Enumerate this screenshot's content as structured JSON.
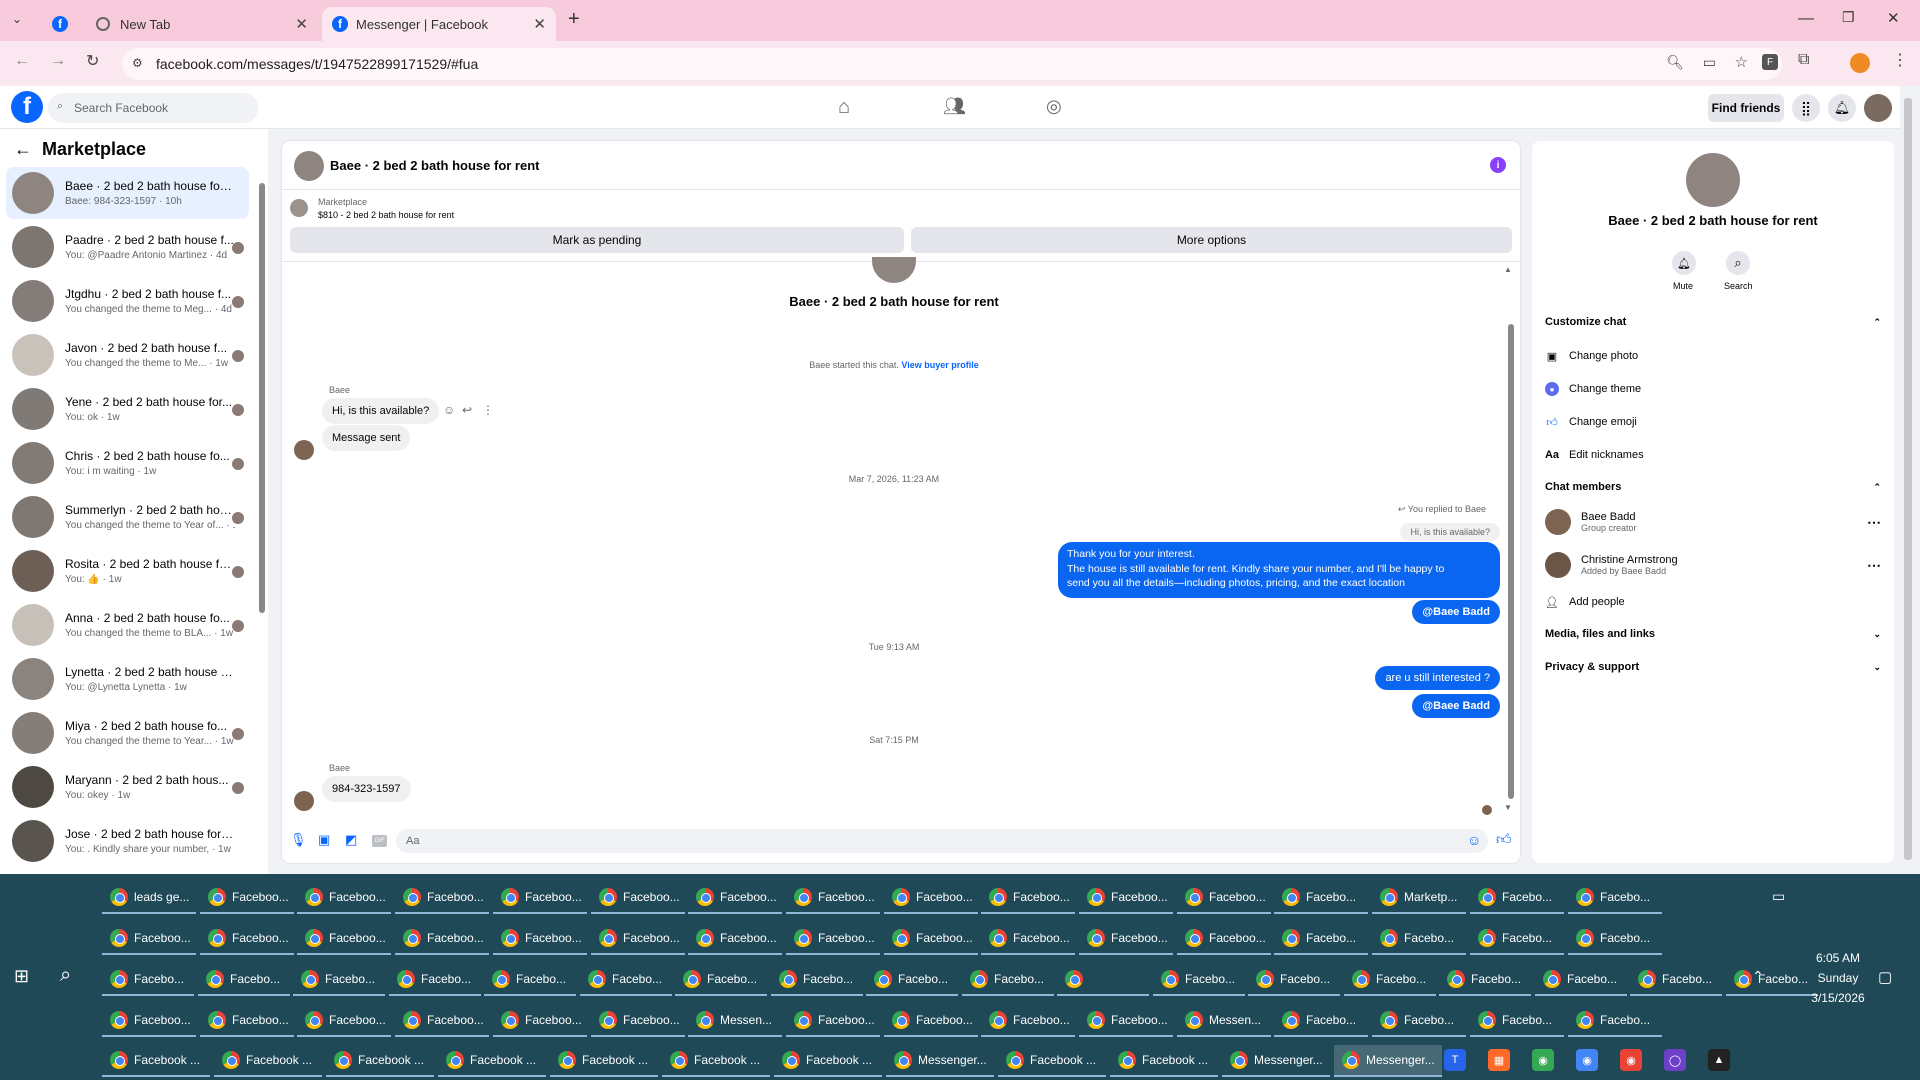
{
  "browser": {
    "tabs": [
      {
        "title": ""
      },
      {
        "title": "New Tab"
      },
      {
        "title": "Messenger | Facebook"
      }
    ],
    "new_tab": "+",
    "url": "facebook.com/messages/t/1947522899171529/#fua"
  },
  "fb": {
    "search_placeholder": "Search Facebook",
    "find_friends": "Find friends"
  },
  "sidebar": {
    "title": "Marketplace",
    "items": [
      {
        "name": "Baee · 2 bed 2 bath house for r...",
        "preview": "Baee: 984-323-1597 · 10h",
        "selected": true,
        "color": "#8f8580"
      },
      {
        "name": "Paadre · 2 bed 2 bath house f...",
        "preview": "You: @Paadre Antonio Martinez · 4d",
        "color": "#7d7570"
      },
      {
        "name": "Jtgdhu · 2 bed 2 bath house f...",
        "preview": "You changed the theme to Meg... · 4d",
        "color": "#847c78"
      },
      {
        "name": "Javon · 2 bed 2 bath house f...",
        "preview": "You changed the theme to Me... · 1w",
        "color": "#c8c2bb"
      },
      {
        "name": "Yene · 2 bed 2 bath house for...",
        "preview": "You: ok · 1w",
        "color": "#7f7a76"
      },
      {
        "name": "Chris · 2 bed 2 bath house fo...",
        "preview": "You: i m waiting · 1w",
        "color": "#827a74"
      },
      {
        "name": "Summerlyn · 2 bed 2 bath hous...",
        "preview": "You changed the theme to Year of... · 1w",
        "color": "#7e7772"
      },
      {
        "name": "Rosita · 2 bed 2 bath house for ...",
        "preview": "You: 👍 · 1w",
        "color": "#6d5f55"
      },
      {
        "name": "Anna · 2 bed 2 bath house fo...",
        "preview": "You changed the theme to BLA... · 1w",
        "color": "#c6c0b9"
      },
      {
        "name": "Lynetta · 2 bed 2 bath house fo...",
        "preview": "You: @Lynetta Lynetta · 1w",
        "color": "#8a837e"
      },
      {
        "name": "Miya · 2 bed 2 bath house fo...",
        "preview": "You changed the theme to Year... · 1w",
        "color": "#847d78"
      },
      {
        "name": "Maryann · 2 bed 2 bath hous...",
        "preview": "You: okey · 1w",
        "color": "#4e4842"
      },
      {
        "name": "Jose · 2 bed 2 bath house for rent",
        "preview": "You: . Kindly share your number, · 1w",
        "color": "#5a544f"
      }
    ]
  },
  "chat": {
    "title": "Baee · 2 bed 2 bath house for rent",
    "listing_label": "Marketplace",
    "listing_price": "$810 - 2 bed 2 bath house for rent",
    "mark_pending": "Mark as pending",
    "more_options": "More options",
    "profile_name": "Baee · 2 bed 2 bath house for rent",
    "started": "Baee started this chat.",
    "view_buyer": "View buyer profile",
    "sender1": "Baee",
    "msg1": "Hi, is this available?",
    "msg2": "Message sent",
    "date1": "Mar 7, 2026, 11:23 AM",
    "replied": "You replied to Baee",
    "quoted": "Hi, is this available?",
    "reply_lines": [
      "Thank you for your interest.",
      "The house is still available for rent. Kindly share your number, and I'll be happy to",
      "send you all the details—including photos, pricing, and the exact location"
    ],
    "mention": "@Baee Badd",
    "date2": "Tue 9:13 AM",
    "msg3": "are u still interested ?",
    "date3": "Sat 7:15 PM",
    "sender2": "Baee",
    "msg4": "984-323-1597",
    "composer_placeholder": "Aa"
  },
  "panel": {
    "name": "Baee · 2 bed 2 bath house for rent",
    "mute": "Mute",
    "search": "Search",
    "customize": "Customize chat",
    "change_photo": "Change photo",
    "change_theme": "Change theme",
    "change_emoji": "Change emoji",
    "edit_nicknames": "Edit nicknames",
    "members_title": "Chat members",
    "members": [
      {
        "name": "Baee Badd",
        "role": "Group creator"
      },
      {
        "name": "Christine Armstrong",
        "role": "Added by Baee Badd"
      }
    ],
    "add_people": "Add people",
    "media": "Media, files and links",
    "privacy": "Privacy & support"
  },
  "taskbar": {
    "rows": [
      [
        "leads ge...",
        "Faceboo...",
        "Faceboo...",
        "Faceboo...",
        "Faceboo...",
        "Faceboo...",
        "Faceboo...",
        "Faceboo...",
        "Faceboo...",
        "Faceboo...",
        "Faceboo...",
        "Faceboo...",
        "Facebo...",
        "Marketp...",
        "Facebo...",
        "Facebo..."
      ],
      [
        "Faceboo...",
        "Faceboo...",
        "Faceboo...",
        "Faceboo...",
        "Faceboo...",
        "Faceboo...",
        "Faceboo...",
        "Faceboo...",
        "Faceboo...",
        "Faceboo...",
        "Faceboo...",
        "Faceboo...",
        "Facebo...",
        "Facebo...",
        "Facebo...",
        "Facebo..."
      ],
      [
        "Facebo...",
        "Facebo...",
        "Facebo...",
        "Facebo...",
        "Facebo...",
        "Facebo...",
        "Facebo...",
        "Facebo...",
        "Facebo...",
        "Facebo...",
        "",
        "Facebo...",
        "Facebo...",
        "Facebo...",
        "Facebo...",
        "Facebo...",
        "Facebo...",
        "Facebo..."
      ],
      [
        "Faceboo...",
        "Faceboo...",
        "Faceboo...",
        "Faceboo...",
        "Faceboo...",
        "Faceboo...",
        "Messen...",
        "Faceboo...",
        "Faceboo...",
        "Faceboo...",
        "Faceboo...",
        "Messen...",
        "Facebo...",
        "Facebo...",
        "Facebo...",
        "Facebo..."
      ],
      [
        "Facebook ...",
        "Facebook ...",
        "Facebook ...",
        "Facebook ...",
        "Facebook ...",
        "Facebook ...",
        "Facebook ...",
        "Messenger...",
        "Facebook ...",
        "Facebook ...",
        "Messenger...",
        "Messenger..."
      ]
    ],
    "time": "6:05 AM",
    "day": "Sunday",
    "date": "3/15/2026"
  },
  "colors": {
    "fb_blue": "#0866ff",
    "bubble_blue": "#0a66f0",
    "tab_bar": "#f7cbdc",
    "taskbar": "#1f4957"
  }
}
